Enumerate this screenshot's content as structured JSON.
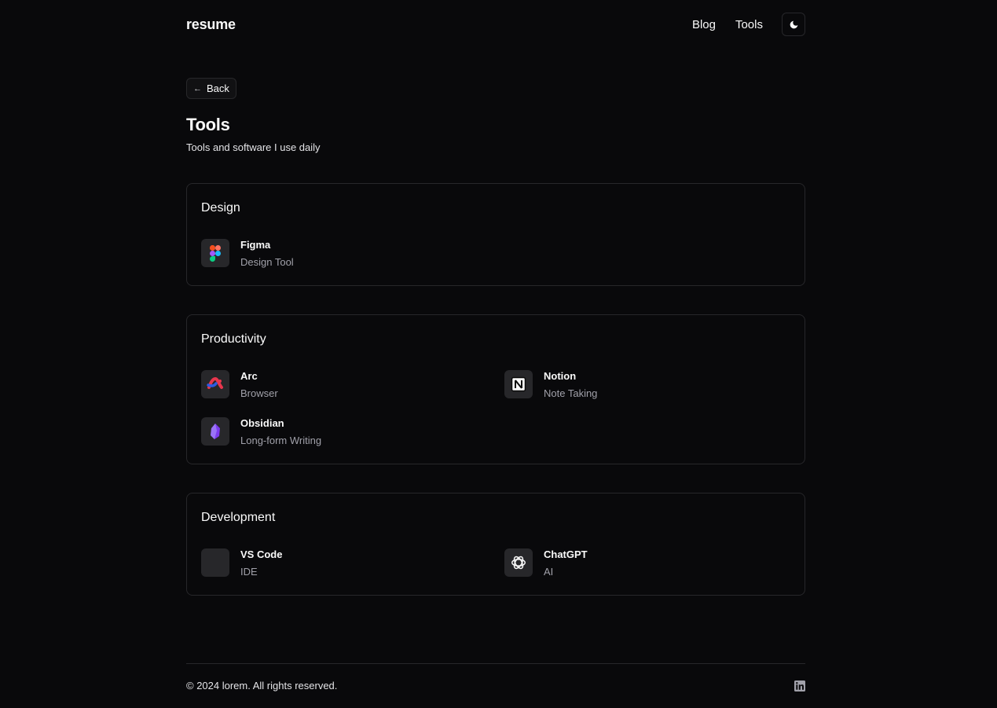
{
  "header": {
    "brand": "resume",
    "nav": [
      "Blog",
      "Tools"
    ],
    "theme_icon": "moon-icon"
  },
  "back": {
    "label": "Back",
    "icon": "arrow-left-icon"
  },
  "page": {
    "title": "Tools",
    "subtitle": "Tools and software I use daily"
  },
  "sections": [
    {
      "title": "Design",
      "tools": [
        {
          "name": "Figma",
          "desc": "Design Tool",
          "icon": "figma-icon"
        }
      ]
    },
    {
      "title": "Productivity",
      "tools": [
        {
          "name": "Arc",
          "desc": "Browser",
          "icon": "arc-icon"
        },
        {
          "name": "Notion",
          "desc": "Note Taking",
          "icon": "notion-icon"
        },
        {
          "name": "Obsidian",
          "desc": "Long-form Writing",
          "icon": "obsidian-icon"
        }
      ]
    },
    {
      "title": "Development",
      "tools": [
        {
          "name": "VS Code",
          "desc": "IDE",
          "icon": "vscode-icon"
        },
        {
          "name": "ChatGPT",
          "desc": "AI",
          "icon": "chatgpt-icon"
        }
      ]
    }
  ],
  "footer": {
    "copyright": "© 2024 lorem. All rights reserved.",
    "social_icon": "linkedin-icon"
  },
  "colors": {
    "background": "#09090b",
    "border": "#27272a",
    "text": "#fafafa",
    "muted": "#a1a1aa",
    "icon_bg": "#27272a"
  }
}
